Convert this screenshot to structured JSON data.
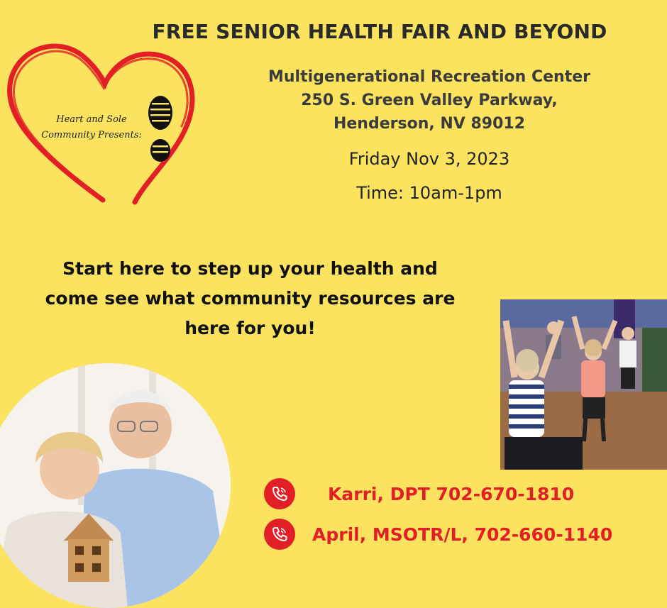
{
  "title": "FREE SENIOR HEALTH FAIR AND BEYOND",
  "venue": {
    "name": "Multigenerational Recreation Center",
    "street": "250 S. Green Valley Parkway,",
    "city": "Henderson, NV 89012"
  },
  "date": "Friday Nov 3, 2023",
  "time": "Time: 10am-1pm",
  "tagline": {
    "line1": "Start here to step up your health and",
    "line2": "come see what community resources are",
    "line3": "here for you!"
  },
  "logo": {
    "line1": "Heart and Sole",
    "line2": "Community Presents:"
  },
  "contacts": [
    {
      "text": "Karri, DPT 702-670-1810",
      "icon": "phone-icon"
    },
    {
      "text": "April, MSOTR/L, 702-660-1140",
      "icon": "phone-icon"
    }
  ],
  "colors": {
    "background": "#fbe35f",
    "accent_red": "#e21f26",
    "heading": "#2a2a2a"
  }
}
